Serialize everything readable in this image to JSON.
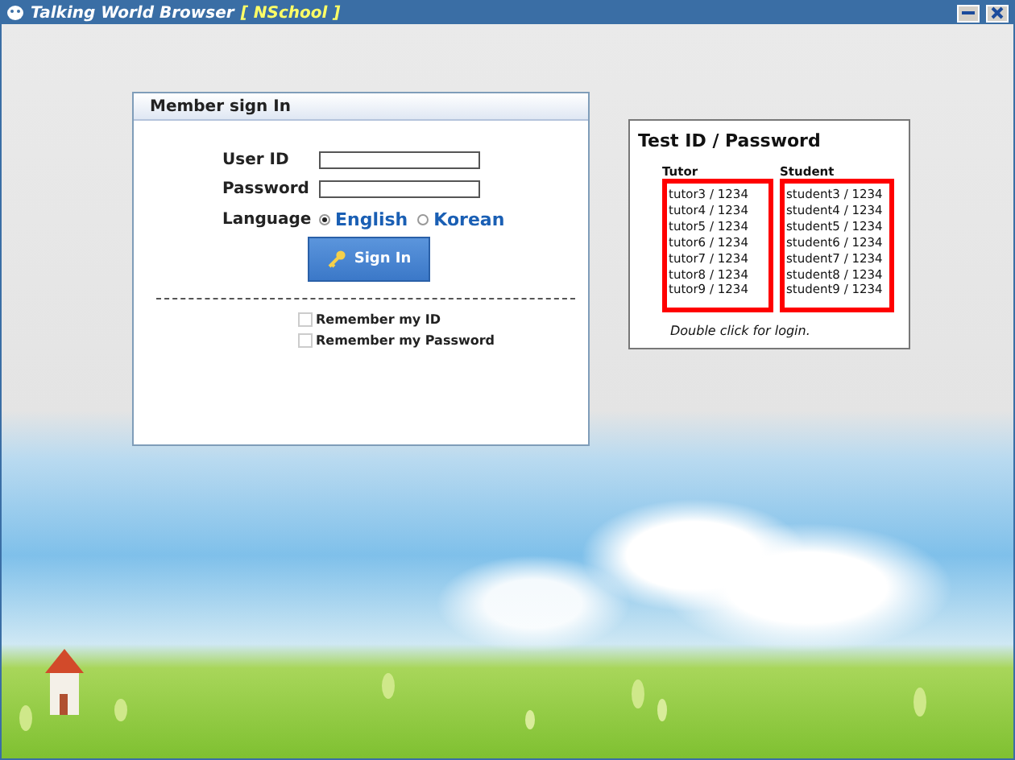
{
  "window": {
    "title": "Talking World Browser",
    "subtitle": "[ NSchool ]"
  },
  "sign_in": {
    "title": "Member sign In",
    "fields": [
      {
        "label": "User ID"
      },
      {
        "label": "Password"
      }
    ],
    "language": {
      "label": "Language",
      "options": [
        {
          "label": "English",
          "selected": true
        },
        {
          "label": "Korean",
          "selected": false
        }
      ]
    },
    "button": "Sign In",
    "checkboxes": [
      {
        "label": "Remember my ID",
        "checked": false
      },
      {
        "label": "Remember my Password",
        "checked": false
      }
    ]
  },
  "test_ids": {
    "title": "Test ID / Password",
    "columns": [
      {
        "heading": "Tutor",
        "items": [
          "tutor3 / 1234",
          "tutor4 / 1234",
          "tutor5 / 1234",
          "tutor6 / 1234",
          "tutor7 / 1234",
          "tutor8 / 1234",
          "tutor9 / 1234"
        ]
      },
      {
        "heading": "Student",
        "items": [
          "student3 / 1234",
          "student4 / 1234",
          "student5 / 1234",
          "student6 / 1234",
          "student7 / 1234",
          "student8 / 1234",
          "student9 / 1234"
        ]
      }
    ],
    "note": "Double click for login."
  }
}
